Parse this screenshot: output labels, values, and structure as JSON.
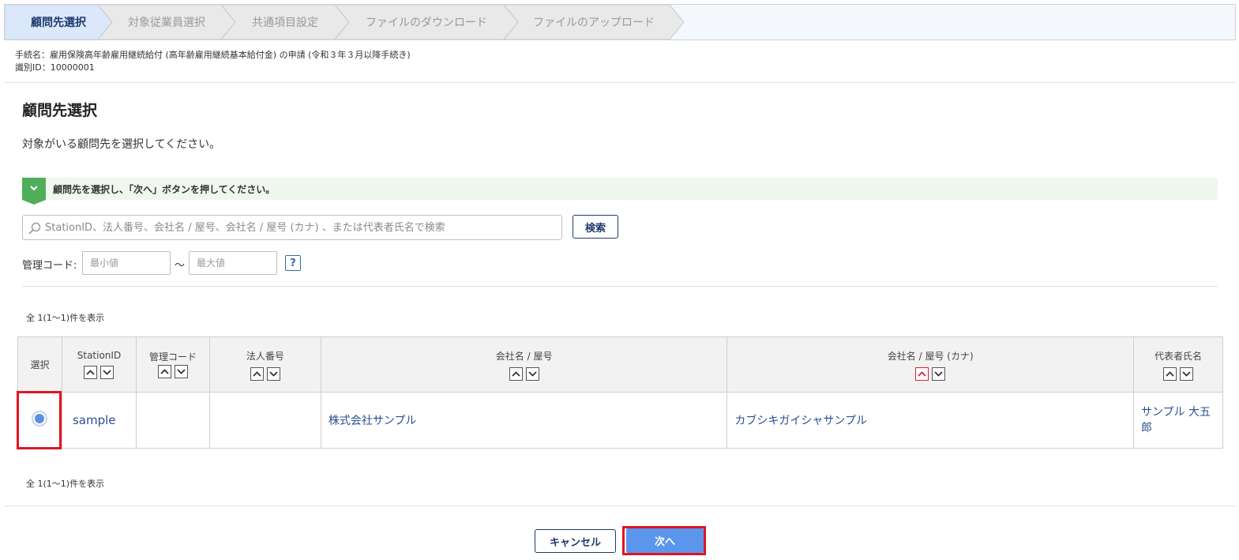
{
  "wizard": {
    "steps": [
      {
        "label": "顧問先選択",
        "active": true
      },
      {
        "label": "対象従業員選択",
        "active": false
      },
      {
        "label": "共通項目設定",
        "active": false
      },
      {
        "label": "ファイルのダウンロード",
        "active": false
      },
      {
        "label": "ファイルのアップロード",
        "active": false
      }
    ]
  },
  "meta": {
    "procedure": "手続名：雇用保険高年齢雇用継続給付 (高年齢雇用継続基本給付金) の申請 (令和３年３月以降手続き)",
    "id": "識別ID：10000001"
  },
  "page": {
    "title": "顧問先選択",
    "description": "対象がいる顧問先を選択してください。"
  },
  "notice": {
    "text": "顧問先を選択し、「次へ」ボタンを押してください。"
  },
  "search": {
    "placeholder": "StationID、法人番号、会社名 / 屋号、会社名 / 屋号 (カナ) 、または代表者氏名で検索",
    "value": "",
    "button_label": "検索"
  },
  "filter": {
    "label": "管理コード:",
    "min_placeholder": "最小値",
    "max_placeholder": "最大値",
    "separator": "～",
    "help_label": "?"
  },
  "results": {
    "count_top": "全 1(1～1)件を表示",
    "count_bottom": "全 1(1～1)件を表示"
  },
  "table": {
    "columns": [
      "選択",
      "StationID",
      "管理コード",
      "法人番号",
      "会社名 / 屋号",
      "会社名 / 屋号 (カナ)",
      "代表者氏名"
    ],
    "rows": [
      {
        "selected": true,
        "station_id": "sample",
        "management_code": "",
        "corporate_number": "",
        "company_name": "株式会社サンプル",
        "company_name_kana": "カブシキガイシャサンプル",
        "representative": "サンプル 大五郎"
      }
    ]
  },
  "footer": {
    "cancel_label": "キャンセル",
    "next_label": "次へ"
  },
  "colors": {
    "accent": "#1f3a6d",
    "primary_button": "#5c96ec",
    "highlight": "#e2141f",
    "notice_badge": "#4fae59"
  }
}
